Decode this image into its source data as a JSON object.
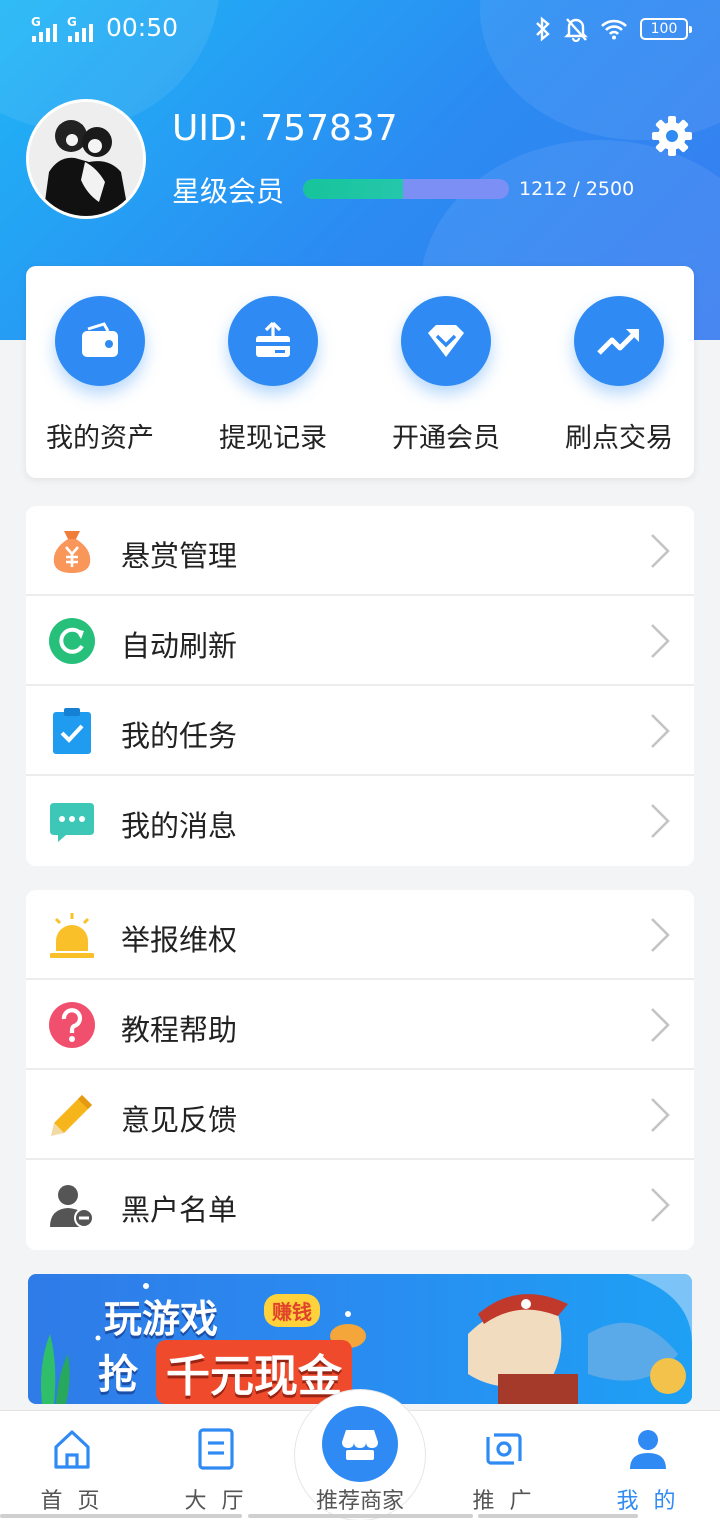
{
  "status_bar": {
    "time": "00:50",
    "battery": "100",
    "signal_label": "G"
  },
  "profile": {
    "uid": "UID: 757837",
    "member_level": "星级会员",
    "progress_text": "1212 / 2500",
    "progress_value": 0.485
  },
  "quick_actions": [
    {
      "label": "我的资产",
      "icon": "wallet-icon"
    },
    {
      "label": "提现记录",
      "icon": "withdraw-icon"
    },
    {
      "label": "开通会员",
      "icon": "diamond-icon"
    },
    {
      "label": "刷点交易",
      "icon": "trend-icon"
    }
  ],
  "menu_group_1": [
    {
      "label": "悬赏管理",
      "icon": "money-bag-icon"
    },
    {
      "label": "自动刷新",
      "icon": "refresh-icon"
    },
    {
      "label": "我的任务",
      "icon": "task-icon"
    },
    {
      "label": "我的消息",
      "icon": "message-icon"
    }
  ],
  "menu_group_2": [
    {
      "label": "举报维权",
      "icon": "alarm-icon"
    },
    {
      "label": "教程帮助",
      "icon": "help-icon"
    },
    {
      "label": "意见反馈",
      "icon": "pencil-icon"
    },
    {
      "label": "黑户名单",
      "icon": "blacklist-icon"
    }
  ],
  "banner": {
    "line1": "玩游戏",
    "line2_prefix": "抢",
    "line2_highlight": "千元现金",
    "badge": "赚钱"
  },
  "tabbar": {
    "home": "首 页",
    "hall": "大 厅",
    "center": "推荐商家",
    "promote": "推 广",
    "mine": "我 的",
    "active_color": "#2f8bf3"
  },
  "colors": {
    "accent": "#2f8bf3",
    "header_start": "#1fb6f6",
    "header_end": "#3a7cf0"
  }
}
